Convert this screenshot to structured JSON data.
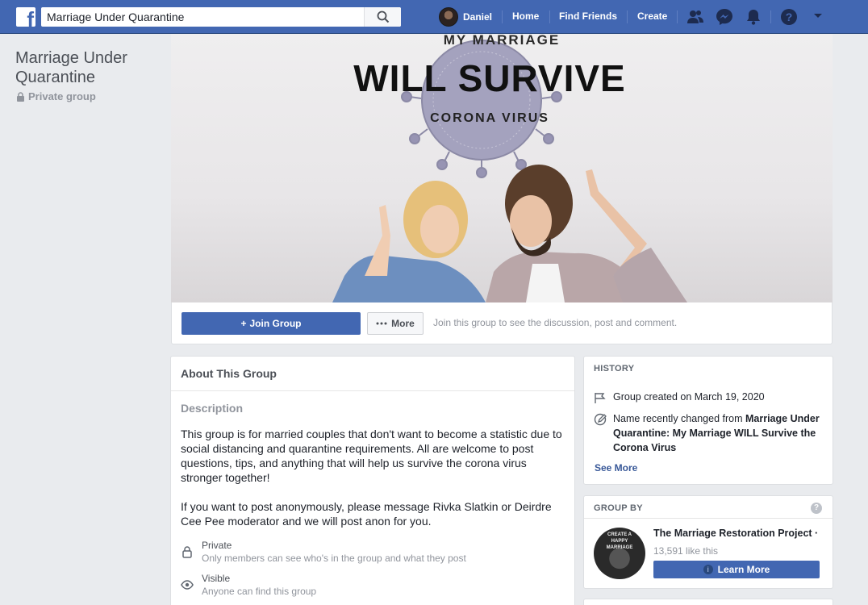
{
  "topbar": {
    "search_value": "Marriage Under Quarantine",
    "user_name": "Daniel",
    "nav": {
      "home": "Home",
      "find_friends": "Find Friends",
      "create": "Create"
    },
    "icons": [
      "facebook-logo-icon",
      "search-icon",
      "friend-requests-icon",
      "messenger-icon",
      "notifications-icon",
      "help-icon",
      "account-menu-icon"
    ]
  },
  "left": {
    "group_name": "Marriage Under Quarantine",
    "privacy": "Private group"
  },
  "cover": {
    "line1": "MY MARRIAGE",
    "line2": "WILL SURVIVE",
    "line3": "CORONA VIRUS"
  },
  "actions": {
    "join": "Join Group",
    "join_symbol": "+",
    "more": "More",
    "hint": "Join this group to see the discussion, post and comment."
  },
  "about": {
    "title": "About This Group",
    "description_label": "Description",
    "description": "This group is for married couples that don't want to become a statistic due to social distancing and quarantine requirements. All are welcome to post questions, tips, and anything that will help us survive the corona virus stronger together!\n\nIf you want to post anonymously, please message Rivka Slatkin or Deirdre Cee Pee moderator and we will post anon for you.",
    "privacy_title": "Private",
    "privacy_sub": "Only members can see who's in the group and what they post",
    "visible_title": "Visible",
    "visible_sub": "Anyone can find this group"
  },
  "history": {
    "label": "HISTORY",
    "created": "Group created on March 19, 2020",
    "renamed_prefix": "Name recently changed from",
    "renamed_from": "Marriage Under Quarantine: My Marriage WILL Survive the Corona Virus",
    "see_more": "See More"
  },
  "group_by": {
    "label": "GROUP BY",
    "help": "?",
    "page_name": "The Marriage Restoration Project ·",
    "likes": "13,591 like this",
    "learn_more": "Learn More",
    "avatar_text1": "CREATE A",
    "avatar_text2": "HAPPY",
    "avatar_text3": "MARRIAGE"
  },
  "colors": {
    "brand": "#4267b2",
    "background": "#e9ebee",
    "link": "#385898"
  }
}
